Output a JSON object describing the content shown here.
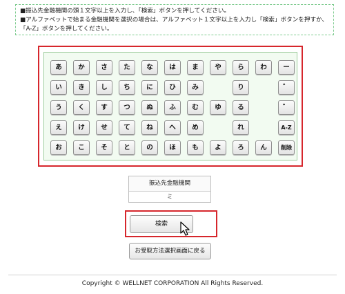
{
  "notice": {
    "line1": "■振込先金融機関の頭１文字以上を入力し、「検索」ボタンを押してください。",
    "line2": "■アルファベットで始まる金融機関を選択の場合は、アルファベット１文字以上を入力し「検索」ボタンを押すか、「A-Z」ボタンを押してください。"
  },
  "keyboard": {
    "row1": [
      "あ",
      "か",
      "さ",
      "た",
      "な",
      "は",
      "ま",
      "や",
      "ら",
      "わ",
      "ー"
    ],
    "row2": [
      "い",
      "き",
      "し",
      "ち",
      "に",
      "ひ",
      "み",
      "",
      "り",
      "",
      "゛"
    ],
    "row3": [
      "う",
      "く",
      "す",
      "つ",
      "ぬ",
      "ふ",
      "む",
      "ゆ",
      "る",
      "",
      "゜"
    ],
    "row4": [
      "え",
      "け",
      "せ",
      "て",
      "ね",
      "へ",
      "め",
      "",
      "れ",
      "",
      "A-Z"
    ],
    "row5": [
      "お",
      "こ",
      "そ",
      "と",
      "の",
      "ほ",
      "も",
      "よ",
      "ろ",
      "ん",
      "削除"
    ]
  },
  "field": {
    "label": "振込先金融機関",
    "value": "ミ"
  },
  "buttons": {
    "search": "検索",
    "back": "お受取方法選択画面に戻る"
  },
  "footer": {
    "copyright": "Copyright © WELLNET CORPORATION All Rights Reserved."
  },
  "colors": {
    "highlight": "#d6262c",
    "keyboard_bg": "#f2fbf1",
    "notice_border": "#7ecb8f"
  }
}
